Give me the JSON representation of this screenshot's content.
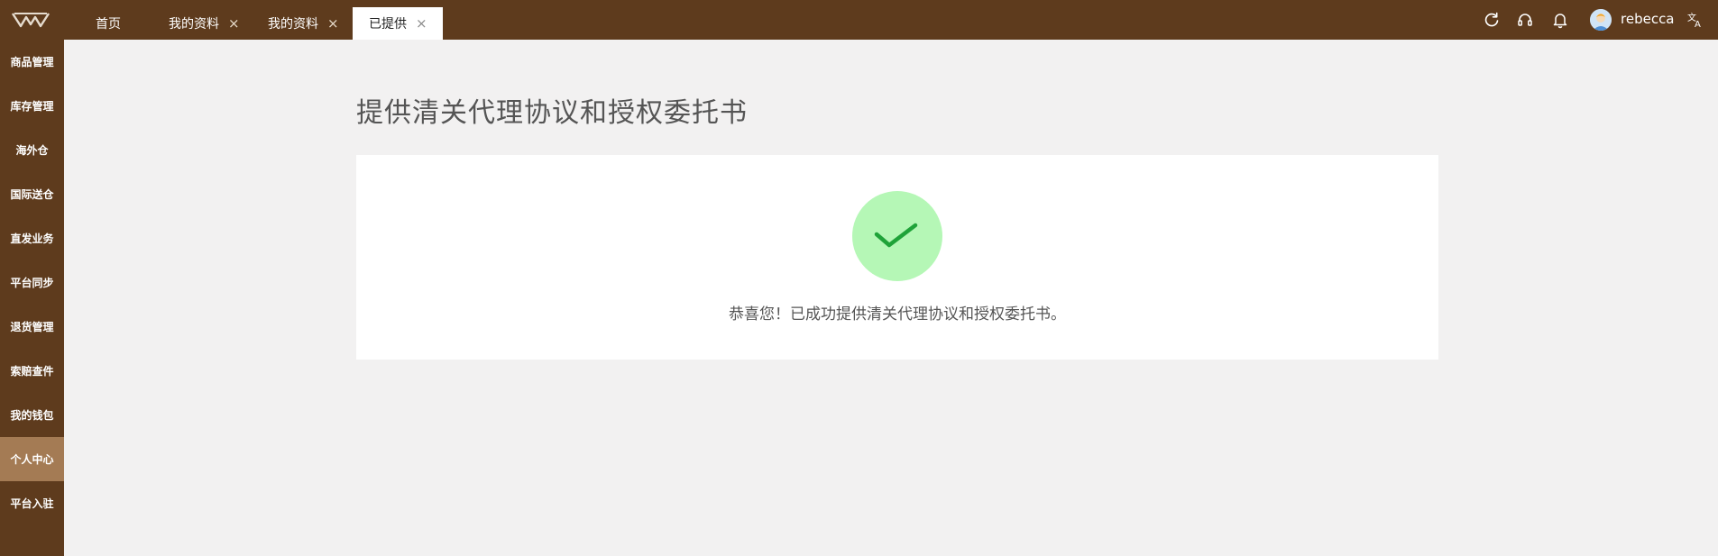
{
  "header": {
    "tabs": [
      {
        "label": "首页",
        "closable": false,
        "active": false
      },
      {
        "label": "我的资料",
        "closable": true,
        "active": false
      },
      {
        "label": "我的资料",
        "closable": true,
        "active": false
      },
      {
        "label": "已提供",
        "closable": true,
        "active": true
      }
    ],
    "close_glyph": "×",
    "icons": [
      "refresh-icon",
      "headset-icon",
      "bell-icon",
      "translate-icon"
    ],
    "user": {
      "name": "rebecca"
    }
  },
  "sidebar": {
    "items": [
      {
        "label": "商品管理"
      },
      {
        "label": "库存管理"
      },
      {
        "label": "海外仓"
      },
      {
        "label": "国际送仓"
      },
      {
        "label": "直发业务"
      },
      {
        "label": "平台同步"
      },
      {
        "label": "退货管理"
      },
      {
        "label": "索赔查件"
      },
      {
        "label": "我的钱包"
      },
      {
        "label": "个人中心",
        "active": true
      },
      {
        "label": "平台入驻"
      }
    ]
  },
  "main": {
    "title": "提供清关代理协议和授权委托书",
    "success_message": "恭喜您！已成功提供清关代理协议和授权委托书。"
  },
  "colors": {
    "brand": "#5e3b1d",
    "sidebar_active": "#a47b54",
    "success_circle": "#b5f7b6",
    "success_check": "#1fa339",
    "page_bg": "#f2f1f1"
  }
}
